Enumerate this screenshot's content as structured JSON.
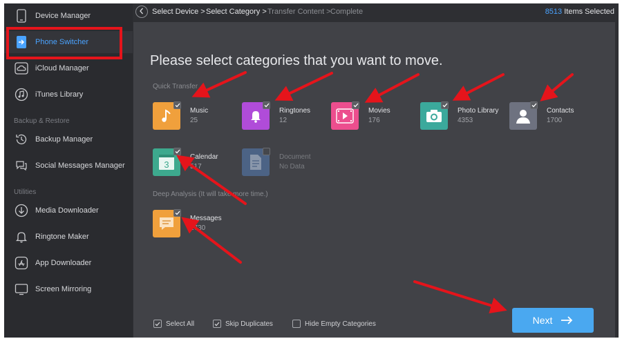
{
  "sidebar": {
    "items": [
      {
        "label": "Device Manager"
      },
      {
        "label": "Phone Switcher"
      },
      {
        "label": "iCloud Manager"
      },
      {
        "label": "iTunes Library"
      },
      {
        "label": "Backup Manager"
      },
      {
        "label": "Social Messages Manager"
      },
      {
        "label": "Media Downloader"
      },
      {
        "label": "Ringtone Maker"
      },
      {
        "label": "App Downloader"
      },
      {
        "label": "Screen Mirroring"
      }
    ],
    "sections": [
      "Backup & Restore",
      "Utilities"
    ],
    "active": "Phone Switcher"
  },
  "topbar": {
    "breadcrumbs": [
      "Select Device >",
      "Select Category >",
      "Transfer Content >",
      "Complete"
    ],
    "items_count": "8513",
    "items_label": "Items Selected"
  },
  "main": {
    "title": "Please select categories that you want to move.",
    "quick_transfer_label": "Quick Transfer",
    "deep_analysis_label": "Deep Analysis (It will take more time.)",
    "categories": [
      {
        "name": "Music",
        "count": "25",
        "color": "#f0a03c",
        "icon": "music-note-icon"
      },
      {
        "name": "Ringtones",
        "count": "12",
        "color": "#b04cd9",
        "icon": "bell-icon"
      },
      {
        "name": "Movies",
        "count": "176",
        "color": "#ec4e8e",
        "icon": "play-icon"
      },
      {
        "name": "Photo Library",
        "count": "4353",
        "color": "#3ba99c",
        "icon": "camera-icon"
      },
      {
        "name": "Contacts",
        "count": "1700",
        "color": "#6e7280",
        "icon": "person-icon"
      },
      {
        "name": "Calendar",
        "count": "517",
        "color": "#3da98e",
        "icon": "calendar-icon"
      },
      {
        "name": "Document",
        "count": "No Data",
        "color": "#4c6385",
        "icon": "document-icon"
      }
    ],
    "deep_categories": [
      {
        "name": "Messages",
        "count": "1730",
        "color": "#f0a03c",
        "icon": "message-icon"
      }
    ],
    "calendar_day": "3"
  },
  "footer": {
    "select_all": "Select All",
    "skip_duplicates": "Skip Duplicates",
    "hide_empty": "Hide Empty Categories",
    "next": "Next"
  }
}
